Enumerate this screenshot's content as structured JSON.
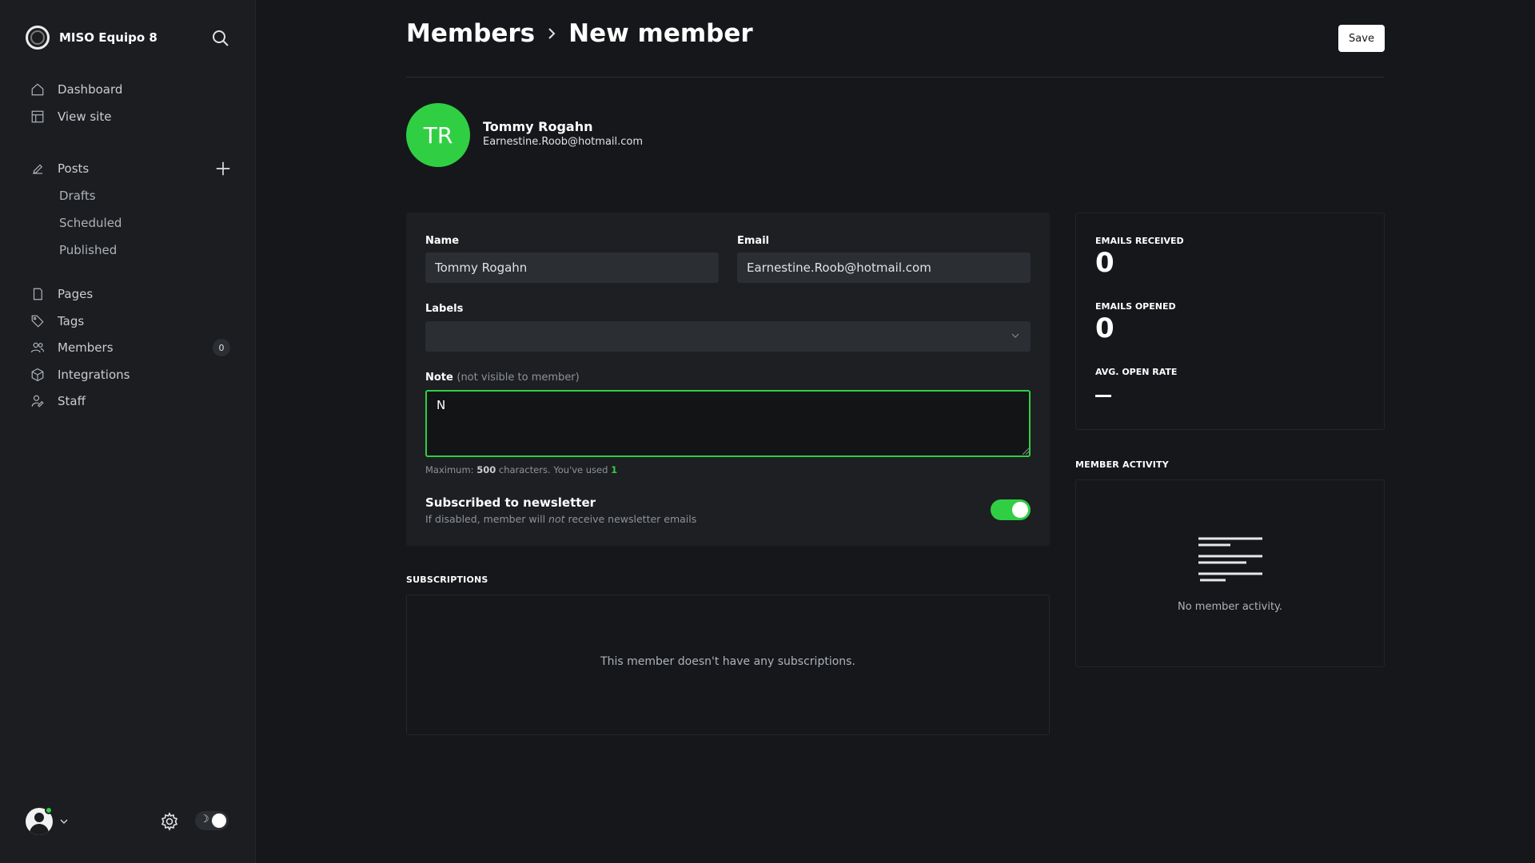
{
  "sidebar": {
    "site_name": "MISO Equipo 8",
    "items": {
      "dashboard": "Dashboard",
      "view_site": "View site",
      "posts": "Posts",
      "drafts": "Drafts",
      "scheduled": "Scheduled",
      "published": "Published",
      "pages": "Pages",
      "tags": "Tags",
      "members": "Members",
      "members_count": "0",
      "integrations": "Integrations",
      "staff": "Staff"
    }
  },
  "header": {
    "breadcrumb_parent": "Members",
    "breadcrumb_current": "New member",
    "save_label": "Save"
  },
  "member": {
    "initials": "TR",
    "name": "Tommy Rogahn",
    "email": "Earnestine.Roob@hotmail.com",
    "avatar_color": "#30cf43"
  },
  "form": {
    "name_label": "Name",
    "name_value": "Tommy Rogahn",
    "email_label": "Email",
    "email_value": "Earnestine.Roob@hotmail.com",
    "labels_label": "Labels",
    "labels_value": "",
    "note_label": "Note",
    "note_hint": "(not visible to member)",
    "note_value": "N",
    "counter_prefix": "Maximum:",
    "counter_max": "500",
    "counter_mid": "characters. You've used",
    "counter_used": "1",
    "newsletter_title": "Subscribed to newsletter",
    "newsletter_desc_pre": "If disabled, member will",
    "newsletter_desc_em": "not",
    "newsletter_desc_post": "receive newsletter emails",
    "newsletter_enabled": true
  },
  "subscriptions": {
    "heading": "SUBSCRIPTIONS",
    "empty": "This member doesn't have any subscriptions."
  },
  "stats": {
    "emails_received_label": "EMAILS RECEIVED",
    "emails_received": "0",
    "emails_opened_label": "EMAILS OPENED",
    "emails_opened": "0",
    "open_rate_label": "AVG. OPEN RATE"
  },
  "activity": {
    "heading": "MEMBER ACTIVITY",
    "empty": "No member activity."
  },
  "colors": {
    "accent": "#30cf43",
    "background": "#15171a",
    "sidebar": "#1b1d20"
  }
}
